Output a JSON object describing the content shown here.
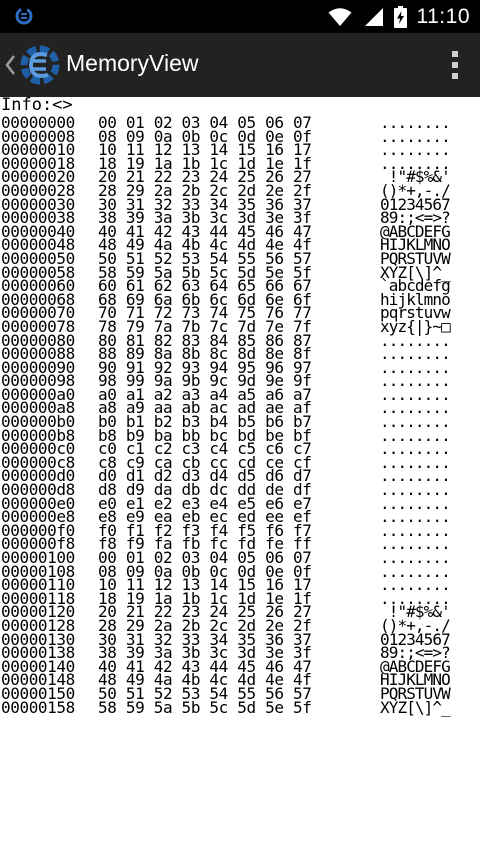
{
  "status_bar": {
    "time": "11:10",
    "icons": [
      "cheat-engine-icon",
      "wifi-icon",
      "battery-charging-icon"
    ],
    "background": "#000000"
  },
  "action_bar": {
    "title": "MemoryView",
    "background": "#222222",
    "logo_color": "#1f5fa8"
  },
  "info": "Info:<>",
  "rows": [
    {
      "addr": "00000000",
      "bytes": "00 01 02 03 04 05 06 07",
      "ascii": "........"
    },
    {
      "addr": "00000008",
      "bytes": "08 09 0a 0b 0c 0d 0e 0f",
      "ascii": "........"
    },
    {
      "addr": "00000010",
      "bytes": "10 11 12 13 14 15 16 17",
      "ascii": "........"
    },
    {
      "addr": "00000018",
      "bytes": "18 19 1a 1b 1c 1d 1e 1f",
      "ascii": "........"
    },
    {
      "addr": "00000020",
      "bytes": "20 21 22 23 24 25 26 27",
      "ascii": " !\"#$%&'"
    },
    {
      "addr": "00000028",
      "bytes": "28 29 2a 2b 2c 2d 2e 2f",
      "ascii": "()*+,-./"
    },
    {
      "addr": "00000030",
      "bytes": "30 31 32 33 34 35 36 37",
      "ascii": "01234567"
    },
    {
      "addr": "00000038",
      "bytes": "38 39 3a 3b 3c 3d 3e 3f",
      "ascii": "89:;<=>?"
    },
    {
      "addr": "00000040",
      "bytes": "40 41 42 43 44 45 46 47",
      "ascii": "@ABCDEFG"
    },
    {
      "addr": "00000048",
      "bytes": "48 49 4a 4b 4c 4d 4e 4f",
      "ascii": "HIJKLMNO"
    },
    {
      "addr": "00000050",
      "bytes": "50 51 52 53 54 55 56 57",
      "ascii": "PQRSTUVW"
    },
    {
      "addr": "00000058",
      "bytes": "58 59 5a 5b 5c 5d 5e 5f",
      "ascii": "XYZ[\\]^_"
    },
    {
      "addr": "00000060",
      "bytes": "60 61 62 63 64 65 66 67",
      "ascii": "`abcdefg"
    },
    {
      "addr": "00000068",
      "bytes": "68 69 6a 6b 6c 6d 6e 6f",
      "ascii": "hijklmno"
    },
    {
      "addr": "00000070",
      "bytes": "70 71 72 73 74 75 76 77",
      "ascii": "pqrstuvw"
    },
    {
      "addr": "00000078",
      "bytes": "78 79 7a 7b 7c 7d 7e 7f",
      "ascii": "xyz{|}~□"
    },
    {
      "addr": "00000080",
      "bytes": "80 81 82 83 84 85 86 87",
      "ascii": "........"
    },
    {
      "addr": "00000088",
      "bytes": "88 89 8a 8b 8c 8d 8e 8f",
      "ascii": "........"
    },
    {
      "addr": "00000090",
      "bytes": "90 91 92 93 94 95 96 97",
      "ascii": "........"
    },
    {
      "addr": "00000098",
      "bytes": "98 99 9a 9b 9c 9d 9e 9f",
      "ascii": "........"
    },
    {
      "addr": "000000a0",
      "bytes": "a0 a1 a2 a3 a4 a5 a6 a7",
      "ascii": "........"
    },
    {
      "addr": "000000a8",
      "bytes": "a8 a9 aa ab ac ad ae af",
      "ascii": "........"
    },
    {
      "addr": "000000b0",
      "bytes": "b0 b1 b2 b3 b4 b5 b6 b7",
      "ascii": "........"
    },
    {
      "addr": "000000b8",
      "bytes": "b8 b9 ba bb bc bd be bf",
      "ascii": "........"
    },
    {
      "addr": "000000c0",
      "bytes": "c0 c1 c2 c3 c4 c5 c6 c7",
      "ascii": "........"
    },
    {
      "addr": "000000c8",
      "bytes": "c8 c9 ca cb cc cd ce cf",
      "ascii": "........"
    },
    {
      "addr": "000000d0",
      "bytes": "d0 d1 d2 d3 d4 d5 d6 d7",
      "ascii": "........"
    },
    {
      "addr": "000000d8",
      "bytes": "d8 d9 da db dc dd de df",
      "ascii": "........"
    },
    {
      "addr": "000000e0",
      "bytes": "e0 e1 e2 e3 e4 e5 e6 e7",
      "ascii": "........"
    },
    {
      "addr": "000000e8",
      "bytes": "e8 e9 ea eb ec ed ee ef",
      "ascii": "........"
    },
    {
      "addr": "000000f0",
      "bytes": "f0 f1 f2 f3 f4 f5 f6 f7",
      "ascii": "........"
    },
    {
      "addr": "000000f8",
      "bytes": "f8 f9 fa fb fc fd fe ff",
      "ascii": "........"
    },
    {
      "addr": "00000100",
      "bytes": "00 01 02 03 04 05 06 07",
      "ascii": "........"
    },
    {
      "addr": "00000108",
      "bytes": "08 09 0a 0b 0c 0d 0e 0f",
      "ascii": "........"
    },
    {
      "addr": "00000110",
      "bytes": "10 11 12 13 14 15 16 17",
      "ascii": "........"
    },
    {
      "addr": "00000118",
      "bytes": "18 19 1a 1b 1c 1d 1e 1f",
      "ascii": "........"
    },
    {
      "addr": "00000120",
      "bytes": "20 21 22 23 24 25 26 27",
      "ascii": " !\"#$%&'"
    },
    {
      "addr": "00000128",
      "bytes": "28 29 2a 2b 2c 2d 2e 2f",
      "ascii": "()*+,-./"
    },
    {
      "addr": "00000130",
      "bytes": "30 31 32 33 34 35 36 37",
      "ascii": "01234567"
    },
    {
      "addr": "00000138",
      "bytes": "38 39 3a 3b 3c 3d 3e 3f",
      "ascii": "89:;<=>?"
    },
    {
      "addr": "00000140",
      "bytes": "40 41 42 43 44 45 46 47",
      "ascii": "@ABCDEFG"
    },
    {
      "addr": "00000148",
      "bytes": "48 49 4a 4b 4c 4d 4e 4f",
      "ascii": "HIJKLMNO"
    },
    {
      "addr": "00000150",
      "bytes": "50 51 52 53 54 55 56 57",
      "ascii": "PQRSTUVW"
    },
    {
      "addr": "00000158",
      "bytes": "58 59 5a 5b 5c 5d 5e 5f",
      "ascii": "XYZ[\\]^_"
    }
  ]
}
